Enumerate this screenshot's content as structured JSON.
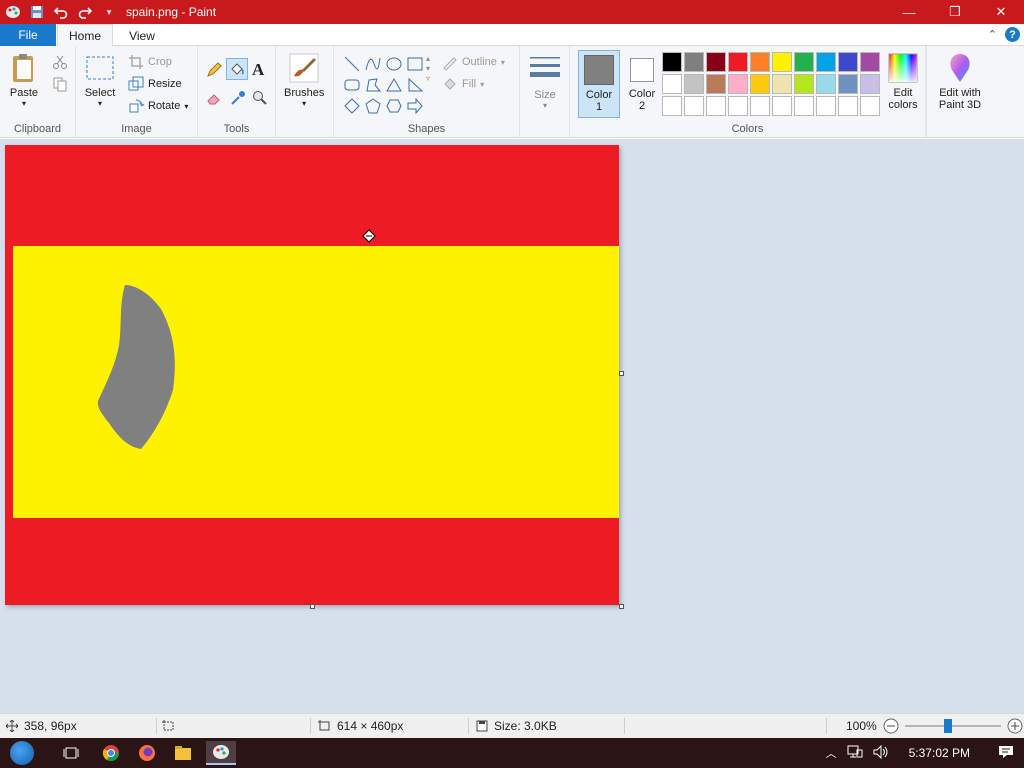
{
  "window": {
    "title": "spain.png - Paint",
    "minimize": "—",
    "maximize": "❐",
    "close": "✕"
  },
  "tabs": {
    "file": "File",
    "home": "Home",
    "view": "View"
  },
  "ribbon": {
    "clipboard": {
      "label": "Clipboard",
      "paste": "Paste"
    },
    "image": {
      "label": "Image",
      "select": "Select",
      "crop": "Crop",
      "resize": "Resize",
      "rotate": "Rotate"
    },
    "tools": {
      "label": "Tools"
    },
    "brushes": "Brushes",
    "shapes": {
      "label": "Shapes",
      "outline": "Outline",
      "fill": "Fill"
    },
    "size": "Size",
    "color1": "Color 1",
    "color2": "Color 2",
    "colors": {
      "label": "Colors",
      "edit": "Edit colors"
    },
    "paint3d": "Edit with Paint 3D"
  },
  "colors": {
    "color1": "#808080",
    "color2": "#ffffff",
    "palette": [
      "#000000",
      "#7f7f7f",
      "#880015",
      "#ed1c24",
      "#ff7f27",
      "#fff200",
      "#22b14c",
      "#00a2e8",
      "#3f48cc",
      "#a349a4",
      "#ffffff",
      "#c3c3c3",
      "#b97a57",
      "#ffaec9",
      "#ffc90e",
      "#efe4b0",
      "#b5e61d",
      "#99d9ea",
      "#7092be",
      "#c8bfe7",
      "#ffffff",
      "#ffffff",
      "#ffffff",
      "#ffffff",
      "#ffffff",
      "#ffffff",
      "#ffffff",
      "#ffffff",
      "#ffffff",
      "#ffffff"
    ],
    "flag_red": "#ed1c24",
    "flag_yellow": "#fff200",
    "blob_gray": "#808080"
  },
  "status": {
    "cursor": "358, 96px",
    "dimensions": "614 × 460px",
    "size": "Size: 3.0KB",
    "zoom": "100%"
  },
  "taskbar": {
    "time": "5:37:02 PM"
  }
}
